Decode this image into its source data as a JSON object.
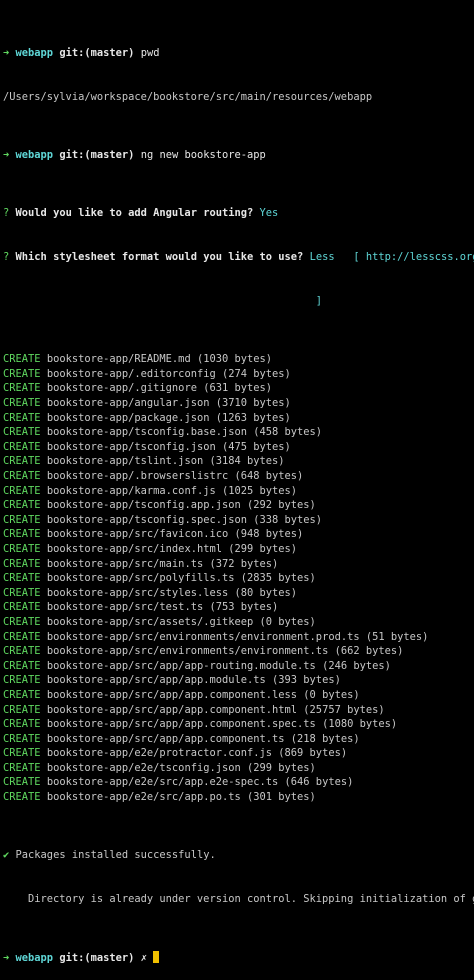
{
  "prompt": {
    "arrow": "➜",
    "dir": "webapp",
    "git_label": "git:",
    "branch": "(master)",
    "dirty_mark": "✗"
  },
  "commands": {
    "pwd": "pwd",
    "pwd_output": "/Users/sylvia/workspace/bookstore/src/main/resources/webapp",
    "ng_new": "ng new bookstore-app"
  },
  "questions": {
    "routing_mark": "?",
    "routing_q": "Would you like to add Angular routing?",
    "routing_a": "Yes",
    "style_mark": "?",
    "style_q": "Which stylesheet format would you like to use?",
    "style_a": "Less",
    "style_hint": "[ http://lesscss.org",
    "style_hint_end": "]"
  },
  "create_label": "CREATE",
  "created_files": [
    "bookstore-app/README.md (1030 bytes)",
    "bookstore-app/.editorconfig (274 bytes)",
    "bookstore-app/.gitignore (631 bytes)",
    "bookstore-app/angular.json (3710 bytes)",
    "bookstore-app/package.json (1263 bytes)",
    "bookstore-app/tsconfig.base.json (458 bytes)",
    "bookstore-app/tsconfig.json (475 bytes)",
    "bookstore-app/tslint.json (3184 bytes)",
    "bookstore-app/.browserslistrc (648 bytes)",
    "bookstore-app/karma.conf.js (1025 bytes)",
    "bookstore-app/tsconfig.app.json (292 bytes)",
    "bookstore-app/tsconfig.spec.json (338 bytes)",
    "bookstore-app/src/favicon.ico (948 bytes)",
    "bookstore-app/src/index.html (299 bytes)",
    "bookstore-app/src/main.ts (372 bytes)",
    "bookstore-app/src/polyfills.ts (2835 bytes)",
    "bookstore-app/src/styles.less (80 bytes)",
    "bookstore-app/src/test.ts (753 bytes)",
    "bookstore-app/src/assets/.gitkeep (0 bytes)",
    "bookstore-app/src/environments/environment.prod.ts (51 bytes)",
    "bookstore-app/src/environments/environment.ts (662 bytes)",
    "bookstore-app/src/app/app-routing.module.ts (246 bytes)",
    "bookstore-app/src/app/app.module.ts (393 bytes)",
    "bookstore-app/src/app/app.component.less (0 bytes)",
    "bookstore-app/src/app/app.component.html (25757 bytes)",
    "bookstore-app/src/app/app.component.spec.ts (1080 bytes)",
    "bookstore-app/src/app/app.component.ts (218 bytes)",
    "bookstore-app/e2e/protractor.conf.js (869 bytes)",
    "bookstore-app/e2e/tsconfig.json (299 bytes)",
    "bookstore-app/e2e/src/app.e2e-spec.ts (646 bytes)",
    "bookstore-app/e2e/src/app.po.ts (301 bytes)"
  ],
  "install": {
    "check": "✔",
    "message": "Packages installed successfully.",
    "git_note": "    Directory is already under version control. Skipping initialization of git."
  },
  "colors": {
    "background": "#000000",
    "text": "#c8c8c8",
    "prompt_green": "#5fd75f",
    "cyan": "#5fd7d7",
    "cursor": "#f0c000"
  }
}
